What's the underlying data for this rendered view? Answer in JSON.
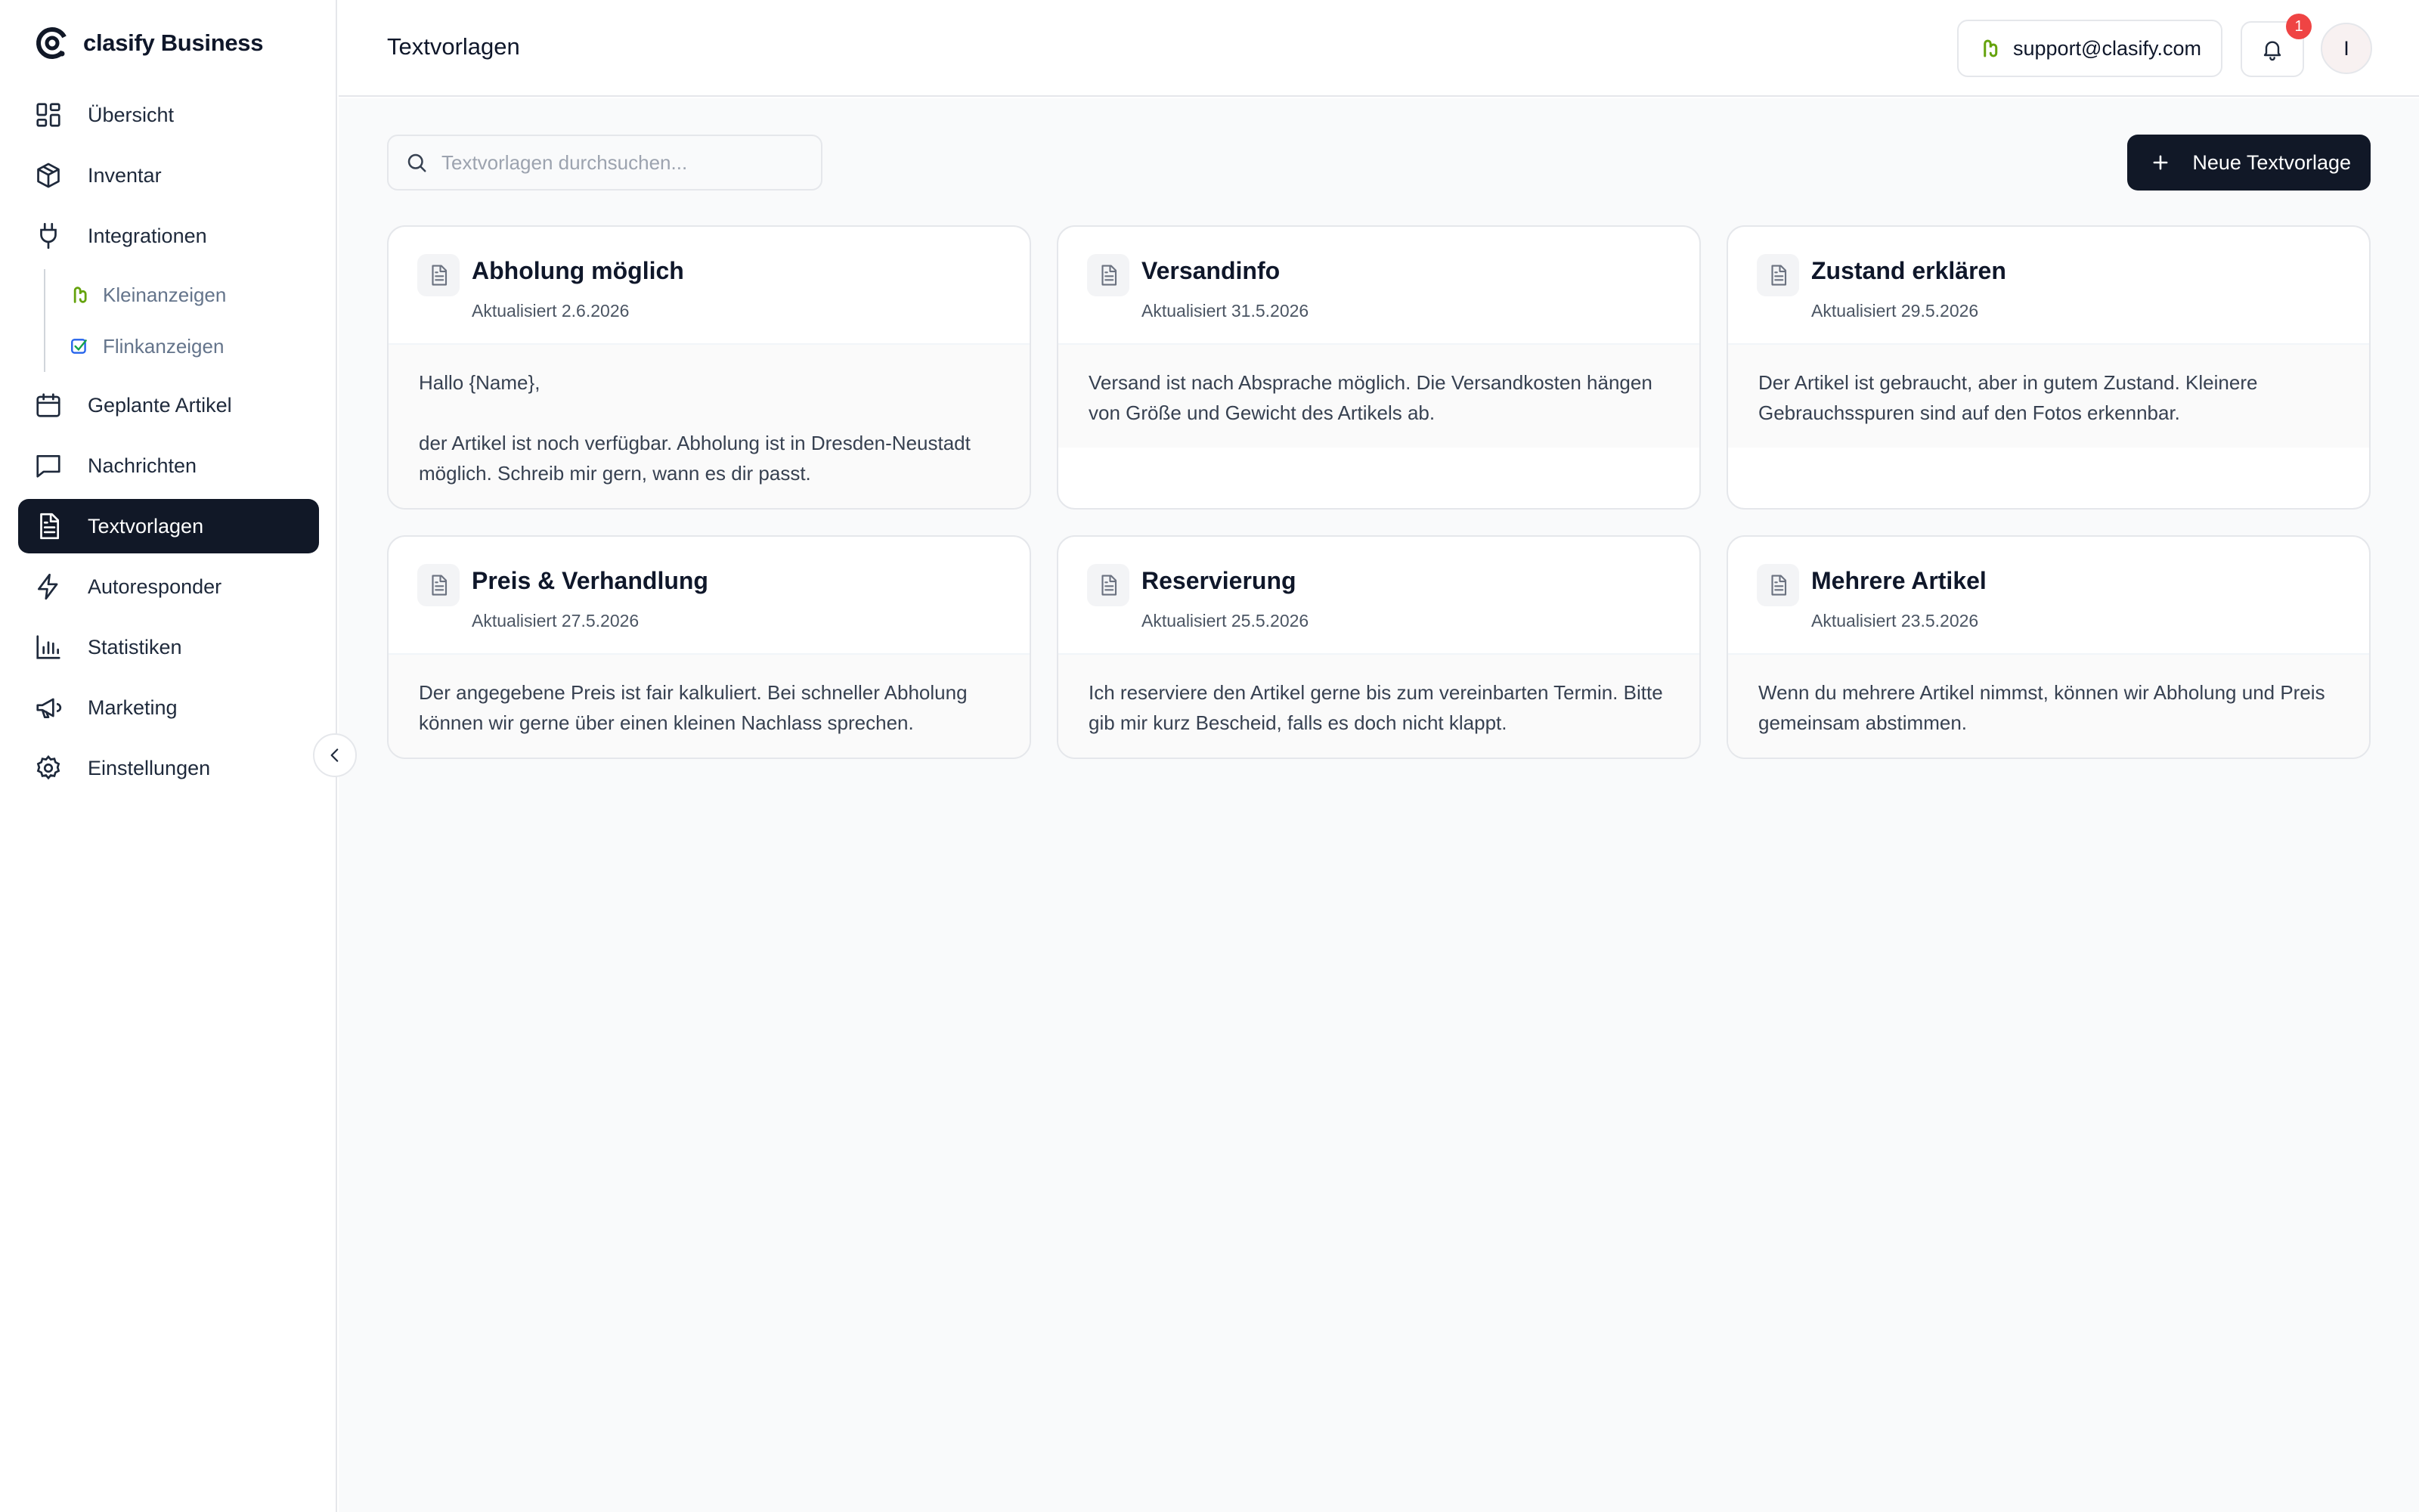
{
  "brand": {
    "name": "clasify Business"
  },
  "sidebar": {
    "items": [
      {
        "label": "Übersicht",
        "icon": "dashboard-icon"
      },
      {
        "label": "Inventar",
        "icon": "box-icon"
      },
      {
        "label": "Integrationen",
        "icon": "plug-icon"
      },
      {
        "label": "Geplante Artikel",
        "icon": "calendar-icon"
      },
      {
        "label": "Nachrichten",
        "icon": "message-icon"
      },
      {
        "label": "Textvorlagen",
        "icon": "document-icon",
        "active": true
      },
      {
        "label": "Autoresponder",
        "icon": "lightning-icon"
      },
      {
        "label": "Statistiken",
        "icon": "bar-chart-icon"
      },
      {
        "label": "Marketing",
        "icon": "megaphone-icon"
      },
      {
        "label": "Einstellungen",
        "icon": "gear-icon"
      }
    ],
    "sub_items": [
      {
        "label": "Kleinanzeigen",
        "icon": "kleinanzeigen-logo-icon"
      },
      {
        "label": "Flinkanzeigen",
        "icon": "flinkanzeigen-logo-icon"
      }
    ]
  },
  "header": {
    "title": "Textvorlagen",
    "support_email": "support@clasify.com",
    "notification_count": "1",
    "avatar_initial": "I"
  },
  "toolbar": {
    "search_placeholder": "Textvorlagen durchsuchen...",
    "new_button_label": "Neue Textvorlage"
  },
  "templates": [
    {
      "title": "Abholung möglich",
      "updated": "Aktualisiert 2.6.2026",
      "text": "Hallo {Name},\n\nder Artikel ist noch verfügbar. Abholung ist in Dresden-Neustadt möglich. Schreib mir gern, wann es dir passt."
    },
    {
      "title": "Versandinfo",
      "updated": "Aktualisiert 31.5.2026",
      "text": "Versand ist nach Absprache möglich. Die Versandkosten hängen von Größe und Gewicht des Artikels ab."
    },
    {
      "title": "Zustand erklären",
      "updated": "Aktualisiert 29.5.2026",
      "text": "Der Artikel ist gebraucht, aber in gutem Zustand. Kleinere Gebrauchsspuren sind auf den Fotos erkennbar."
    },
    {
      "title": "Preis & Verhandlung",
      "updated": "Aktualisiert 27.5.2026",
      "text": "Der angegebene Preis ist fair kalkuliert. Bei schneller Abholung können wir gerne über einen kleinen Nachlass sprechen."
    },
    {
      "title": "Reservierung",
      "updated": "Aktualisiert 25.5.2026",
      "text": "Ich reserviere den Artikel gerne bis zum vereinbarten Termin. Bitte gib mir kurz Bescheid, falls es doch nicht klappt."
    },
    {
      "title": "Mehrere Artikel",
      "updated": "Aktualisiert 23.5.2026",
      "text": "Wenn du mehrere Artikel nimmst, können wir Abholung und Preis gemeinsam abstimmen."
    }
  ],
  "colors": {
    "accent_dark": "#111827",
    "badge_red": "#ef4444",
    "kleinanzeigen_green": "#65a30d",
    "border": "#e5e7eb"
  }
}
